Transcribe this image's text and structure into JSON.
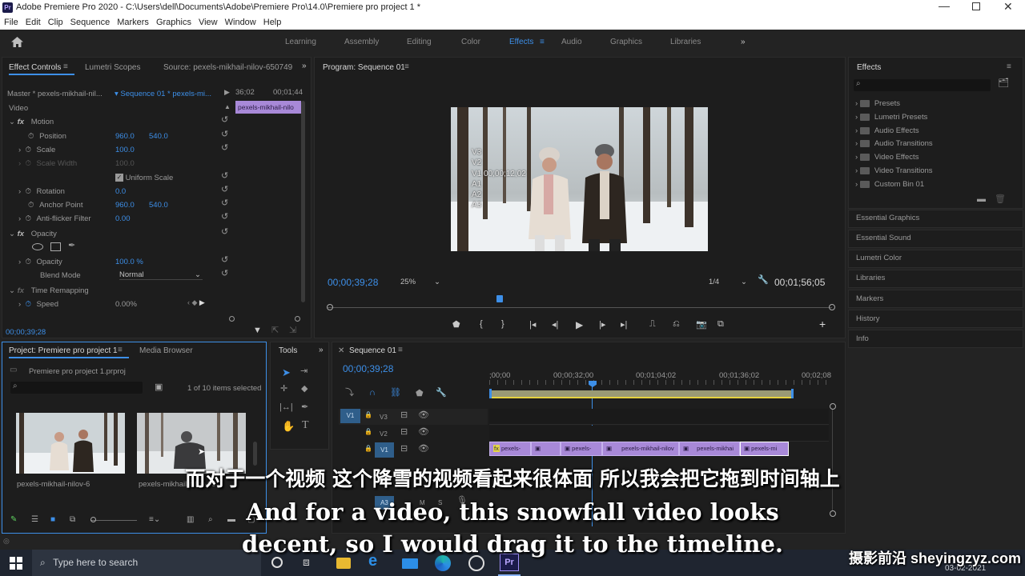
{
  "app": {
    "title": "Adobe Premiere Pro 2020 - C:\\Users\\dell\\Documents\\Adobe\\Premiere Pro\\14.0\\Premiere pro project 1 *",
    "logo": "Pr"
  },
  "menu": [
    "File",
    "Edit",
    "Clip",
    "Sequence",
    "Markers",
    "Graphics",
    "View",
    "Window",
    "Help"
  ],
  "workspaces": [
    "Learning",
    "Assembly",
    "Editing",
    "Color",
    "Effects",
    "Audio",
    "Graphics",
    "Libraries"
  ],
  "active_workspace": "Effects",
  "effect_controls": {
    "tabs": [
      "Effect Controls",
      "Lumetri Scopes",
      "Source: pexels-mikhail-nilov-650749"
    ],
    "master": "Master * pexels-mikhail-nil...",
    "sequence": "Sequence 01 * pexels-mi...",
    "ruler": [
      "36;02",
      "00;01;44"
    ],
    "clip_label": "pexels-mikhail-nilo",
    "section_video": "Video",
    "motion": "Motion",
    "position_label": "Position",
    "position_x": "960.0",
    "position_y": "540.0",
    "scale_label": "Scale",
    "scale": "100.0",
    "scale_width_label": "Scale Width",
    "scale_width": "100.0",
    "uniform_scale": "Uniform Scale",
    "rotation_label": "Rotation",
    "rotation": "0.0",
    "anchor_label": "Anchor Point",
    "anchor_x": "960.0",
    "anchor_y": "540.0",
    "antiflicker_label": "Anti-flicker Filter",
    "antiflicker": "0.00",
    "opacity_section": "Opacity",
    "opacity_label": "Opacity",
    "opacity": "100.0 %",
    "blend_label": "Blend Mode",
    "blend": "Normal",
    "time_remap": "Time Remapping",
    "speed_label": "Speed",
    "speed": "0.00%",
    "timecode": "00;00;39;28"
  },
  "program": {
    "tab": "Program: Sequence 01",
    "overlay": [
      "V3",
      "V2",
      "V1 00;00;12;02",
      "A1",
      "A2",
      "A3"
    ],
    "timecode": "00;00;39;28",
    "zoom": "25%",
    "resolution": "1/4",
    "duration": "00;01;56;05"
  },
  "effects": {
    "title": "Effects",
    "folders": [
      "Presets",
      "Lumetri Presets",
      "Audio Effects",
      "Audio Transitions",
      "Video Effects",
      "Video Transitions",
      "Custom Bin 01"
    ],
    "panels": [
      "Essential Graphics",
      "Essential Sound",
      "Lumetri Color",
      "Libraries",
      "Markers",
      "History",
      "Info"
    ]
  },
  "project": {
    "tabs": [
      "Project: Premiere pro project 1",
      "Media Browser"
    ],
    "file": "Premiere pro project 1.prproj",
    "selected": "1 of 10 items selected",
    "items": [
      "pexels-mikhail-nilov-6",
      "pexels-mikhail-nilov-65"
    ]
  },
  "tools": {
    "title": "Tools"
  },
  "timeline": {
    "tab": "Sequence 01",
    "timecode": "00;00;39;28",
    "ruler": [
      ";00;00",
      "00;00;32;00",
      "00;01;04;02",
      "00;01;36;02",
      "00;02;08"
    ],
    "tracks_video": [
      "V3",
      "V2",
      "V1"
    ],
    "tracks_audio": [
      "A1",
      "A2",
      "A3"
    ],
    "source_v": "V1",
    "source_a": "A3",
    "mute": "M",
    "solo": "S",
    "clips": [
      "pexels-",
      "",
      "pexels-",
      "pexels-mikhail-nilov",
      "pexels-mikhai",
      "pexels-mi"
    ],
    "playhead_fraction": 0.31
  },
  "subtitles": {
    "zh": "而对于一个视频 这个降雪的视频看起来很体面 所以我会把它拖到时间轴上",
    "en1": "And for a video, this snowfall video looks",
    "en2": "decent, so I would drag it to the timeline."
  },
  "taskbar": {
    "search": "Type here to search",
    "date": "03-02-2021"
  },
  "watermark": "摄影前沿 sheyingzyz.com"
}
